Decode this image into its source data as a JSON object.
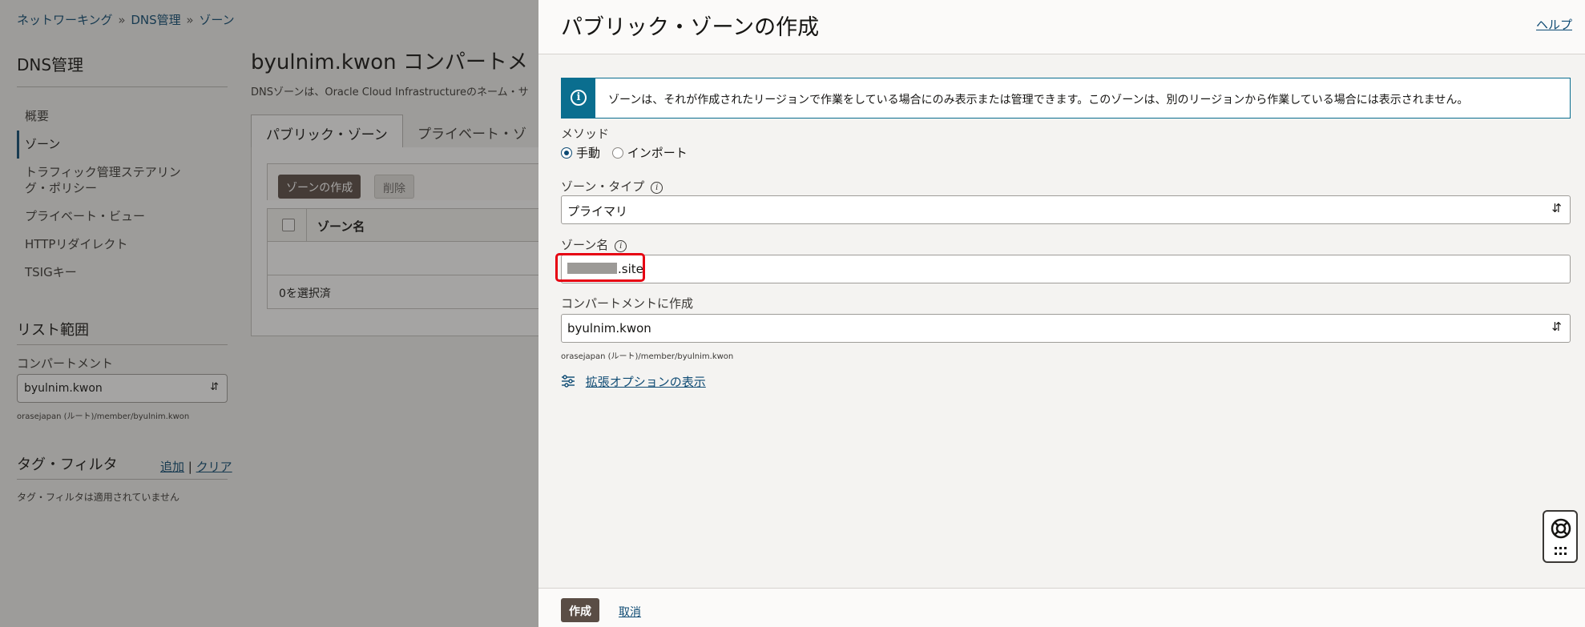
{
  "breadcrumb": [
    "ネットワーキング",
    "DNS管理",
    "ゾーン"
  ],
  "breadcrumb_sep": "»",
  "sidebar": {
    "title": "DNS管理",
    "items": [
      {
        "label": "概要"
      },
      {
        "label": "ゾーン",
        "active": true
      },
      {
        "label": "トラフィック管理ステアリング・ポリシー"
      },
      {
        "label": "プライベート・ビュー"
      },
      {
        "label": "HTTPリダイレクト"
      },
      {
        "label": "TSIGキー"
      }
    ],
    "list_scope": "リスト範囲",
    "compartment_label": "コンパートメント",
    "compartment_value": "byulnim.kwon",
    "compartment_path": "orasejapan (ルート)/member/byulnim.kwon",
    "tag_filter": "タグ・フィルタ",
    "tag_add": "追加",
    "tag_sep": "|",
    "tag_clear": "クリア",
    "tag_note": "タグ・フィルタは適用されていません"
  },
  "main": {
    "title": "byulnim.kwon コンパートメ",
    "description": "DNSゾーンは、Oracle Cloud Infrastructureのネーム・サ",
    "tabs": [
      {
        "label": "パブリック・ゾーン",
        "active": true
      },
      {
        "label": "プライベート・ゾ"
      }
    ],
    "create_zone_button": "ゾーンの作成",
    "delete_button": "削除",
    "column_zone_name": "ゾーン名",
    "selected_count": "0を選択済"
  },
  "drawer": {
    "title": "パブリック・ゾーンの作成",
    "help": "ヘルプ",
    "info_icon": "i",
    "info_text": "ゾーンは、それが作成されたリージョンで作業をしている場合にのみ表示または管理できます。このゾーンは、別のリージョンから作業している場合には表示されません。",
    "method_label": "メソッド",
    "method_options": [
      {
        "label": "手動",
        "checked": true
      },
      {
        "label": "インポート",
        "checked": false
      }
    ],
    "zone_type_label": "ゾーン・タイプ",
    "zone_type_value": "プライマリ",
    "zone_name_label": "ゾーン名",
    "zone_name_suffix": ".site",
    "compartment_label": "コンパートメントに作成",
    "compartment_value": "byulnim.kwon",
    "compartment_path": "orasejapan (ルート)/member/byulnim.kwon",
    "advanced_options": "拡張オプションの表示",
    "create_button": "作成",
    "cancel_link": "取消"
  },
  "icons": {
    "info": "info-icon",
    "help_tooltip": "info-tooltip-icon",
    "select_chevron": "chevron-updown-icon",
    "advanced": "sliders-icon",
    "help_widget": "lifebuoy-icon",
    "apps": "grid-icon"
  },
  "colors": {
    "accent": "#0d4a73",
    "primary_button": "#5a4d45",
    "info": "#0a6e8f",
    "highlight": "#e60012"
  }
}
